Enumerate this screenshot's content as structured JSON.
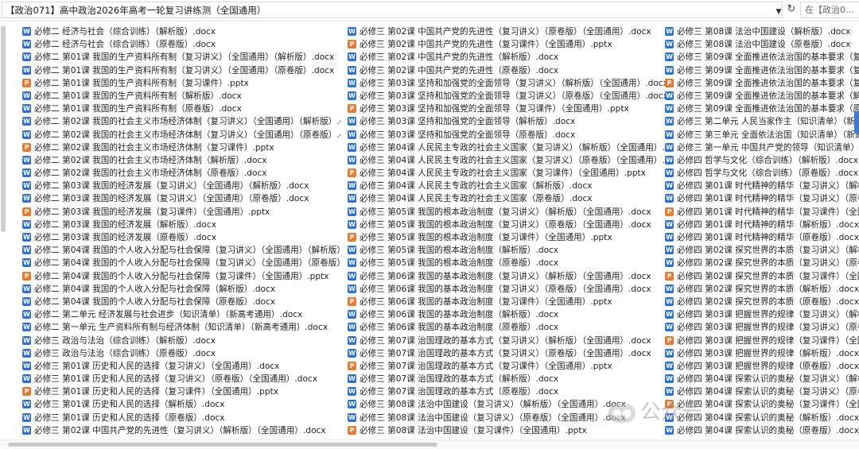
{
  "address_bar": {
    "path": "【政治071】高中政治2026年高考一轮复习讲练测（全国通用）",
    "search_placeholder": "在【政治0..."
  },
  "icons": {
    "docx": "word-document-icon",
    "pptx": "powerpoint-document-icon"
  },
  "colors": {
    "docx_icon": "#2f6fd6",
    "pptx_icon": "#e8792e"
  },
  "watermark": "公众号",
  "columns": [
    {
      "files": [
        {
          "name": "必修二 经济与社会（综合训练）（解析版）.docx",
          "type": "docx"
        },
        {
          "name": "必修二 经济与社会（综合训练）（原卷版）.docx",
          "type": "docx"
        },
        {
          "name": "必修二 第01课 我国的生产资料所有制（复习讲义）（全国通用）（解析版）.docx",
          "type": "docx"
        },
        {
          "name": "必修二 第01课 我国的生产资料所有制（复习讲义）（全国通用）（原卷版）.docx",
          "type": "docx"
        },
        {
          "name": "必修二 第01课 我国的生产资料所有制（复习课件）.pptx",
          "type": "pptx"
        },
        {
          "name": "必修二 第01课 我国的生产资料所有制（解析版）.docx",
          "type": "docx"
        },
        {
          "name": "必修二 第01课 我国的生产资料所有制（原卷版）.docx",
          "type": "docx"
        },
        {
          "name": "必修二 第02课 我国的社会主义市场经济体制（复习讲义）（全国通用）（解析版）.docx",
          "type": "docx"
        },
        {
          "name": "必修二 第02课 我国的社会主义市场经济体制（复习讲义）（全国通用）（原卷版）.docx",
          "type": "docx"
        },
        {
          "name": "必修二 第02课 我国的社会主义市场经济体制（复习课件）.pptx",
          "type": "pptx"
        },
        {
          "name": "必修二 第02课 我国的社会主义市场经济体制（解析版）.docx",
          "type": "docx"
        },
        {
          "name": "必修二 第02课 我国的社会主义市场经济体制（原卷版）.docx",
          "type": "docx"
        },
        {
          "name": "必修二 第03课 我国的经济发展（复习讲义）（全国通用）（解析版）.docx",
          "type": "docx"
        },
        {
          "name": "必修二 第03课 我国的经济发展（复习讲义）（全国通用）（原卷版）.docx",
          "type": "docx"
        },
        {
          "name": "必修二 第03课 我国的经济发展（复习课件）（全国通用）.pptx",
          "type": "pptx"
        },
        {
          "name": "必修二 第03课 我国的经济发展（解析版）.docx",
          "type": "docx"
        },
        {
          "name": "必修二 第03课 我国的经济发展（原卷版）.docx",
          "type": "docx"
        },
        {
          "name": "必修二 第04课 我国的个人收入分配与社会保障（复习讲义）（全国通用）（解析版）.docx",
          "type": "docx"
        },
        {
          "name": "必修二 第04课 我国的个人收入分配与社会保障（复习讲义）（全国通用）（原卷版）.docx",
          "type": "docx"
        },
        {
          "name": "必修二 第04课 我国的个人收入分配与社会保障（复习课件）（全国通用）.pptx",
          "type": "pptx"
        },
        {
          "name": "必修二 第04课 我国的个人收入分配与社会保障（解析版）.docx",
          "type": "docx"
        },
        {
          "name": "必修二 第04课 我国的个人收入分配与社会保障（原卷版）.docx",
          "type": "docx"
        },
        {
          "name": "必修二 第二单元 经济发展与社会进步（知识清单）（新高考通用）.docx",
          "type": "docx"
        },
        {
          "name": "必修二 第一单元 生产资料所有制与经济体制（知识清单）（新高考通用）.docx",
          "type": "docx"
        },
        {
          "name": "必修三 政治与法治（综合训练）（解析版）.docx",
          "type": "docx"
        },
        {
          "name": "必修三 政治与法治（综合训练）（原卷版）.docx",
          "type": "docx"
        },
        {
          "name": "必修三 第01课 历史和人民的选择（复习讲义）（全国通用）.docx",
          "type": "docx"
        },
        {
          "name": "必修三 第01课 历史和人民的选择（复习讲义）（原卷版）（全国通用）.docx",
          "type": "docx"
        },
        {
          "name": "必修三 第01课 历史和人民的选择（复习课件）（全国通用）.pptx",
          "type": "pptx"
        },
        {
          "name": "必修三 第01课 历史和人民的选择（解析版）.docx",
          "type": "docx"
        },
        {
          "name": "必修三 第01课 历史和人民的选择（原卷版）.docx",
          "type": "docx"
        },
        {
          "name": "必修三 第02课 中国共产党的先进性（复习讲义）（解析版）（全国通用）.docx",
          "type": "docx"
        }
      ]
    },
    {
      "files": [
        {
          "name": "必修三 第02课 中国共产党的先进性（复习讲义）（原卷版）（全国通用）.docx",
          "type": "docx"
        },
        {
          "name": "必修三 第02课 中国共产党的先进性（复习课件）（全国通用）.pptx",
          "type": "pptx"
        },
        {
          "name": "必修三 第02课 中国共产党的先进性（解析版）.docx",
          "type": "docx"
        },
        {
          "name": "必修三 第02课 中国共产党的先进性（原卷版）.docx",
          "type": "docx"
        },
        {
          "name": "必修三 第03课 坚持和加强党的全面领导（复习讲义）（解析版）（全国通用）.docx",
          "type": "docx"
        },
        {
          "name": "必修三 第03课 坚持和加强党的全面领导（复习讲义）（原卷版）（全国通用）.docx",
          "type": "docx"
        },
        {
          "name": "必修三 第03课 坚持和加强党的全面领导（复习课件）（全国通用）.pptx",
          "type": "pptx"
        },
        {
          "name": "必修三 第03课 坚持和加强党的全面领导（解析版）.docx",
          "type": "docx"
        },
        {
          "name": "必修三 第03课 坚持和加强党的全面领导（原卷版）.docx",
          "type": "docx"
        },
        {
          "name": "必修三 第04课 人民民主专政的社会主义国家（复习讲义）（解析版）（全国通用）.docx",
          "type": "docx"
        },
        {
          "name": "必修三 第04课 人民民主专政的社会主义国家（复习讲义）（原卷版）（全国通用）.docx",
          "type": "docx"
        },
        {
          "name": "必修三 第04课 人民民主专政的社会主义国家（复习课件）（全国通用）.pptx",
          "type": "pptx"
        },
        {
          "name": "必修三 第04课 人民民主专政的社会主义国家（解析版）.docx",
          "type": "docx"
        },
        {
          "name": "必修三 第04课 人民民主专政的社会主义国家（原卷版）.docx",
          "type": "docx"
        },
        {
          "name": "必修三 第05课 我国的根本政治制度（复习讲义）（解析版）（全国通用）.docx",
          "type": "docx"
        },
        {
          "name": "必修三 第05课 我国的根本政治制度（复习讲义）（原卷版）（全国通用）.docx",
          "type": "docx"
        },
        {
          "name": "必修三 第05课 我国的根本政治制度（复习课件）（全国通用）.pptx",
          "type": "pptx"
        },
        {
          "name": "必修三 第05课 我国的根本政治制度（解析版）.docx",
          "type": "docx"
        },
        {
          "name": "必修三 第05课 我国的根本政治制度（原卷版）.docx",
          "type": "docx"
        },
        {
          "name": "必修三 第06课 我国的基本政治制度（复习讲义）（解析版）（全国通用）.docx",
          "type": "docx"
        },
        {
          "name": "必修三 第06课 我国的基本政治制度（复习讲义）（原卷版）（全国通用）.docx",
          "type": "docx"
        },
        {
          "name": "必修三 第06课 我国的基本政治制度（复习课件）（全国通用）.pptx",
          "type": "pptx"
        },
        {
          "name": "必修三 第06课 我国的基本政治制度（解析版）.docx",
          "type": "docx"
        },
        {
          "name": "必修三 第06课 我国的基本政治制度（原卷版）.docx",
          "type": "docx"
        },
        {
          "name": "必修三 第07课 治国理政的基本方式（复习讲义）（解析版）（全国通用）.docx",
          "type": "docx"
        },
        {
          "name": "必修三 第07课 治国理政的基本方式（复习讲义）（原卷版）（全国通用）.docx",
          "type": "docx"
        },
        {
          "name": "必修三 第07课 治国理政的基本方式（复习课件）（全国通用）.pptx",
          "type": "pptx"
        },
        {
          "name": "必修三 第07课 治国理政的基本方式（解析版）.docx",
          "type": "docx"
        },
        {
          "name": "必修三 第07课 治国理政的基本方式（原卷版）.docx",
          "type": "docx"
        },
        {
          "name": "必修三 第08课 法治中国建设（复习讲义）（解析版）（全国通用）.docx",
          "type": "docx"
        },
        {
          "name": "必修三 第08课 法治中国建设（复习讲义）（原卷版）（全国通用）.docx",
          "type": "docx"
        },
        {
          "name": "必修三 第08课 法治中国建设（复习课件）（全国通用）.pptx",
          "type": "pptx"
        }
      ]
    },
    {
      "files": [
        {
          "name": "必修三 第08课 法治中国建设（解析版）.docx",
          "type": "docx"
        },
        {
          "name": "必修三 第08课 法治中国建设（原卷版）.docx",
          "type": "docx"
        },
        {
          "name": "必修三 第09课 全面推进依法治国的基本要求（复习讲义）",
          "type": "docx"
        },
        {
          "name": "必修三 第09课 全面推进依法治国的基本要求（复习讲义）",
          "type": "docx"
        },
        {
          "name": "必修三 第09课 全面推进依法治国的基本要求（复习课件）",
          "type": "pptx"
        },
        {
          "name": "必修三 第09课 全面推进依法治国的基本要求（解析版）",
          "type": "docx"
        },
        {
          "name": "必修三 第09课 全面推进依法治国的基本要求（原卷版）",
          "type": "docx"
        },
        {
          "name": "必修三 第二单元 人民当家作主（知识清单）（新高考通",
          "type": "docx"
        },
        {
          "name": "必修三 第三单元 全面依法治国（知识清单）（新高考通",
          "type": "docx"
        },
        {
          "name": "必修三 第一单元 中国共产党的领导（知识清单）（新高",
          "type": "docx"
        },
        {
          "name": "必修四 哲学与文化（综合训练）（解析版）.docx",
          "type": "docx"
        },
        {
          "name": "必修四 哲学与文化（综合训练）（原卷版）.docx",
          "type": "docx"
        },
        {
          "name": "必修四 第01课 时代精神的精华（复习讲义）（解析版）",
          "type": "docx"
        },
        {
          "name": "必修四 第01课 时代精神的精华（复习讲义）（原卷版）",
          "type": "docx"
        },
        {
          "name": "必修四 第01课 时代精神的精华（复习课件）（全国通用",
          "type": "pptx"
        },
        {
          "name": "必修四 第01课 时代精神的精华（解析版）.docx",
          "type": "docx"
        },
        {
          "name": "必修四 第01课 时代精神的精华（原卷版）.docx",
          "type": "docx"
        },
        {
          "name": "必修四 第02课 探究世界的本质（复习讲义）（解析版）",
          "type": "docx"
        },
        {
          "name": "必修四 第02课 探究世界的本质（复习讲义）（原卷版）",
          "type": "docx"
        },
        {
          "name": "必修四 第02课 探究世界的本质（复习课件）（全国通用",
          "type": "pptx"
        },
        {
          "name": "必修四 第02课 探究世界的本质（解析版）.docx",
          "type": "docx"
        },
        {
          "name": "必修四 第02课 探究世界的本质（原卷版）.docx",
          "type": "docx"
        },
        {
          "name": "必修四 第03课 把握世界的规律（复习讲义）（解析版）",
          "type": "docx"
        },
        {
          "name": "必修四 第03课 把握世界的规律（复习讲义）（原卷版）",
          "type": "docx"
        },
        {
          "name": "必修四 第03课 把握世界的规律（复习课件）（全国通用",
          "type": "pptx"
        },
        {
          "name": "必修四 第03课 把握世界的规律（解析版）.docx",
          "type": "docx"
        },
        {
          "name": "必修四 第03课 把握世界的规律（原卷版）.docx",
          "type": "docx"
        },
        {
          "name": "必修四 第04课 探索认识的奥秘（复习讲义）（解析版）",
          "type": "docx"
        },
        {
          "name": "必修四 第04课 探索认识的奥秘（复习讲义）（原卷版）",
          "type": "docx"
        },
        {
          "name": "必修四 第04课 探索认识的奥秘（复习课件）（全国通用",
          "type": "pptx"
        },
        {
          "name": "必修四 第04课 探索认识的奥秘（解析版）.docx",
          "type": "docx"
        },
        {
          "name": "必修四 第04课 探索认识的奥秘（原卷版）.docx",
          "type": "docx"
        }
      ]
    }
  ]
}
